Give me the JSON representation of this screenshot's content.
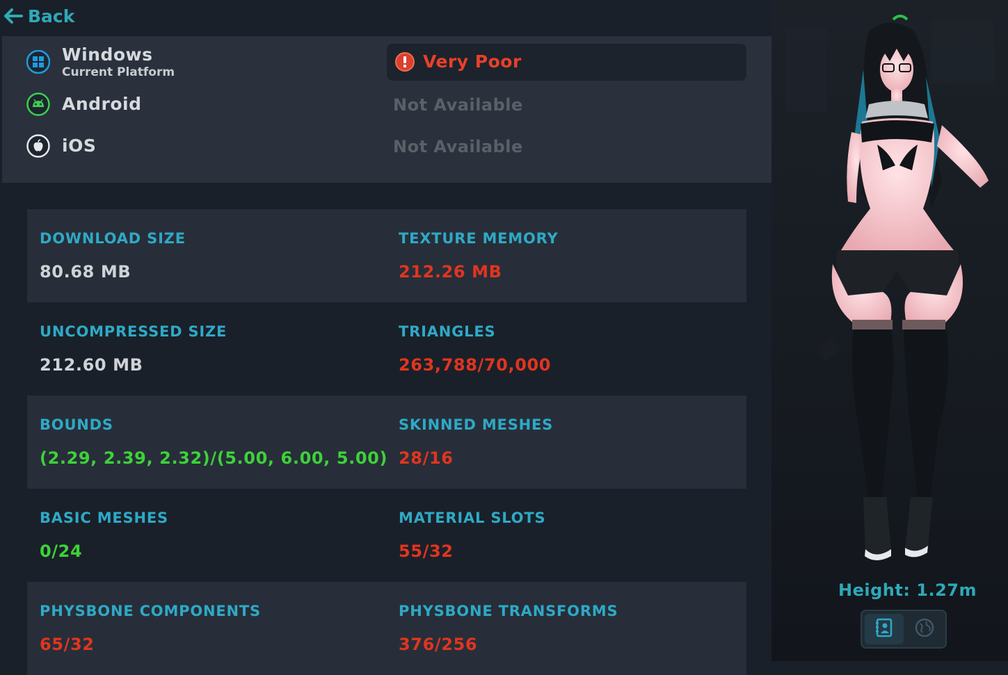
{
  "nav": {
    "back_label": "Back"
  },
  "platforms": [
    {
      "name": "Windows",
      "subtitle": "Current Platform",
      "icon": "windows-icon",
      "rating": "Very Poor"
    },
    {
      "name": "Android",
      "icon": "android-icon",
      "rating": "Not Available"
    },
    {
      "name": "iOS",
      "icon": "apple-icon",
      "rating": "Not Available"
    }
  ],
  "colors": {
    "accent": "#2ea9c6",
    "bad": "#e0351f",
    "good": "#3ed13a",
    "neutral": "#cfd3d8"
  },
  "stats": [
    {
      "label": "DOWNLOAD SIZE",
      "value": "80.68 MB",
      "status": "neutral"
    },
    {
      "label": "TEXTURE MEMORY",
      "value": "212.26 MB",
      "status": "bad"
    },
    {
      "label": "UNCOMPRESSED SIZE",
      "value": "212.60 MB",
      "status": "neutral"
    },
    {
      "label": "TRIANGLES",
      "value": "263,788/70,000",
      "status": "bad"
    },
    {
      "label": "BOUNDS",
      "value": "(2.29, 2.39, 2.32)/(5.00, 6.00, 5.00)",
      "status": "good"
    },
    {
      "label": "SKINNED MESHES",
      "value": "28/16",
      "status": "bad"
    },
    {
      "label": "BASIC MESHES",
      "value": "0/24",
      "status": "good"
    },
    {
      "label": "MATERIAL SLOTS",
      "value": "55/32",
      "status": "bad"
    },
    {
      "label": "PHYSBONE COMPONENTS",
      "value": "65/32",
      "status": "bad"
    },
    {
      "label": "PHYSBONE TRANSFORMS",
      "value": "376/256",
      "status": "bad"
    }
  ],
  "avatar": {
    "height_text": "Height: 1.27m",
    "view_toggles": [
      {
        "icon": "avatar-details-icon",
        "active": true
      },
      {
        "icon": "world-globe-icon",
        "active": false
      }
    ]
  }
}
